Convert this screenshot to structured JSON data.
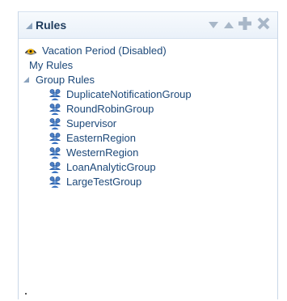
{
  "panel": {
    "title": "Rules",
    "header_icons": [
      "triangle-down-icon",
      "triangle-up-icon",
      "plus-icon",
      "close-icon"
    ]
  },
  "tree": {
    "vacation": {
      "label": "Vacation Period (Disabled)",
      "icon": "eye-icon"
    },
    "my_rules": {
      "label": "My Rules"
    },
    "group_rules": {
      "label": "Group Rules",
      "icon": "group-icon",
      "items": [
        {
          "label": "DuplicateNotificationGroup"
        },
        {
          "label": "RoundRobinGroup"
        },
        {
          "label": "Supervisor"
        },
        {
          "label": "EasternRegion"
        },
        {
          "label": "WesternRegion"
        },
        {
          "label": "LoanAnalyticGroup"
        },
        {
          "label": "LargeTestGroup"
        }
      ]
    }
  },
  "colors": {
    "text": "#1c4879",
    "title": "#1f3c5e",
    "header_bg": "#eaf1f9",
    "border": "#c9d7e8",
    "icon_grey": "#a8b7c8"
  }
}
